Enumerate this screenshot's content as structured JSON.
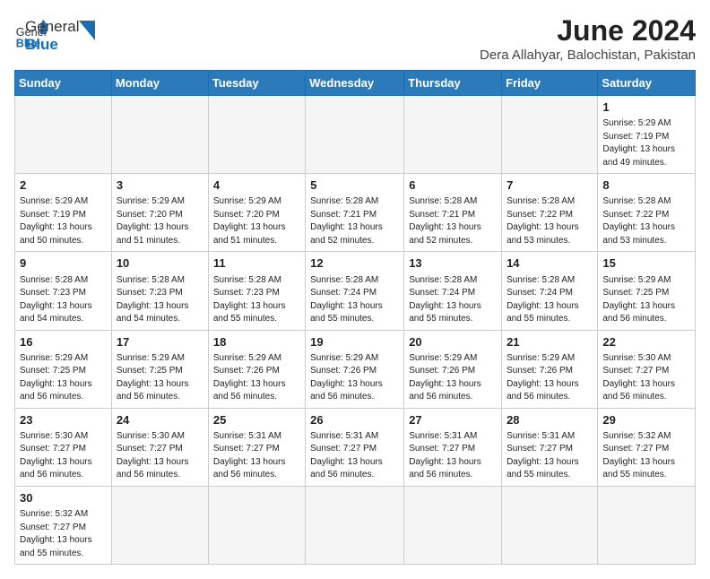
{
  "header": {
    "logo_general": "General",
    "logo_blue": "Blue",
    "month_title": "June 2024",
    "location": "Dera Allahyar, Balochistan, Pakistan"
  },
  "weekdays": [
    "Sunday",
    "Monday",
    "Tuesday",
    "Wednesday",
    "Thursday",
    "Friday",
    "Saturday"
  ],
  "weeks": [
    [
      {
        "day": null,
        "info": ""
      },
      {
        "day": null,
        "info": ""
      },
      {
        "day": null,
        "info": ""
      },
      {
        "day": null,
        "info": ""
      },
      {
        "day": null,
        "info": ""
      },
      {
        "day": null,
        "info": ""
      },
      {
        "day": "1",
        "info": "Sunrise: 5:29 AM\nSunset: 7:19 PM\nDaylight: 13 hours\nand 49 minutes."
      }
    ],
    [
      {
        "day": "2",
        "info": "Sunrise: 5:29 AM\nSunset: 7:19 PM\nDaylight: 13 hours\nand 50 minutes."
      },
      {
        "day": "3",
        "info": "Sunrise: 5:29 AM\nSunset: 7:20 PM\nDaylight: 13 hours\nand 51 minutes."
      },
      {
        "day": "4",
        "info": "Sunrise: 5:29 AM\nSunset: 7:20 PM\nDaylight: 13 hours\nand 51 minutes."
      },
      {
        "day": "5",
        "info": "Sunrise: 5:28 AM\nSunset: 7:21 PM\nDaylight: 13 hours\nand 52 minutes."
      },
      {
        "day": "6",
        "info": "Sunrise: 5:28 AM\nSunset: 7:21 PM\nDaylight: 13 hours\nand 52 minutes."
      },
      {
        "day": "7",
        "info": "Sunrise: 5:28 AM\nSunset: 7:22 PM\nDaylight: 13 hours\nand 53 minutes."
      },
      {
        "day": "8",
        "info": "Sunrise: 5:28 AM\nSunset: 7:22 PM\nDaylight: 13 hours\nand 53 minutes."
      }
    ],
    [
      {
        "day": "9",
        "info": "Sunrise: 5:28 AM\nSunset: 7:23 PM\nDaylight: 13 hours\nand 54 minutes."
      },
      {
        "day": "10",
        "info": "Sunrise: 5:28 AM\nSunset: 7:23 PM\nDaylight: 13 hours\nand 54 minutes."
      },
      {
        "day": "11",
        "info": "Sunrise: 5:28 AM\nSunset: 7:23 PM\nDaylight: 13 hours\nand 55 minutes."
      },
      {
        "day": "12",
        "info": "Sunrise: 5:28 AM\nSunset: 7:24 PM\nDaylight: 13 hours\nand 55 minutes."
      },
      {
        "day": "13",
        "info": "Sunrise: 5:28 AM\nSunset: 7:24 PM\nDaylight: 13 hours\nand 55 minutes."
      },
      {
        "day": "14",
        "info": "Sunrise: 5:28 AM\nSunset: 7:24 PM\nDaylight: 13 hours\nand 55 minutes."
      },
      {
        "day": "15",
        "info": "Sunrise: 5:29 AM\nSunset: 7:25 PM\nDaylight: 13 hours\nand 56 minutes."
      }
    ],
    [
      {
        "day": "16",
        "info": "Sunrise: 5:29 AM\nSunset: 7:25 PM\nDaylight: 13 hours\nand 56 minutes."
      },
      {
        "day": "17",
        "info": "Sunrise: 5:29 AM\nSunset: 7:25 PM\nDaylight: 13 hours\nand 56 minutes."
      },
      {
        "day": "18",
        "info": "Sunrise: 5:29 AM\nSunset: 7:26 PM\nDaylight: 13 hours\nand 56 minutes."
      },
      {
        "day": "19",
        "info": "Sunrise: 5:29 AM\nSunset: 7:26 PM\nDaylight: 13 hours\nand 56 minutes."
      },
      {
        "day": "20",
        "info": "Sunrise: 5:29 AM\nSunset: 7:26 PM\nDaylight: 13 hours\nand 56 minutes."
      },
      {
        "day": "21",
        "info": "Sunrise: 5:29 AM\nSunset: 7:26 PM\nDaylight: 13 hours\nand 56 minutes."
      },
      {
        "day": "22",
        "info": "Sunrise: 5:30 AM\nSunset: 7:27 PM\nDaylight: 13 hours\nand 56 minutes."
      }
    ],
    [
      {
        "day": "23",
        "info": "Sunrise: 5:30 AM\nSunset: 7:27 PM\nDaylight: 13 hours\nand 56 minutes."
      },
      {
        "day": "24",
        "info": "Sunrise: 5:30 AM\nSunset: 7:27 PM\nDaylight: 13 hours\nand 56 minutes."
      },
      {
        "day": "25",
        "info": "Sunrise: 5:31 AM\nSunset: 7:27 PM\nDaylight: 13 hours\nand 56 minutes."
      },
      {
        "day": "26",
        "info": "Sunrise: 5:31 AM\nSunset: 7:27 PM\nDaylight: 13 hours\nand 56 minutes."
      },
      {
        "day": "27",
        "info": "Sunrise: 5:31 AM\nSunset: 7:27 PM\nDaylight: 13 hours\nand 56 minutes."
      },
      {
        "day": "28",
        "info": "Sunrise: 5:31 AM\nSunset: 7:27 PM\nDaylight: 13 hours\nand 55 minutes."
      },
      {
        "day": "29",
        "info": "Sunrise: 5:32 AM\nSunset: 7:27 PM\nDaylight: 13 hours\nand 55 minutes."
      }
    ],
    [
      {
        "day": "30",
        "info": "Sunrise: 5:32 AM\nSunset: 7:27 PM\nDaylight: 13 hours\nand 55 minutes."
      },
      {
        "day": null,
        "info": ""
      },
      {
        "day": null,
        "info": ""
      },
      {
        "day": null,
        "info": ""
      },
      {
        "day": null,
        "info": ""
      },
      {
        "day": null,
        "info": ""
      },
      {
        "day": null,
        "info": ""
      }
    ]
  ]
}
